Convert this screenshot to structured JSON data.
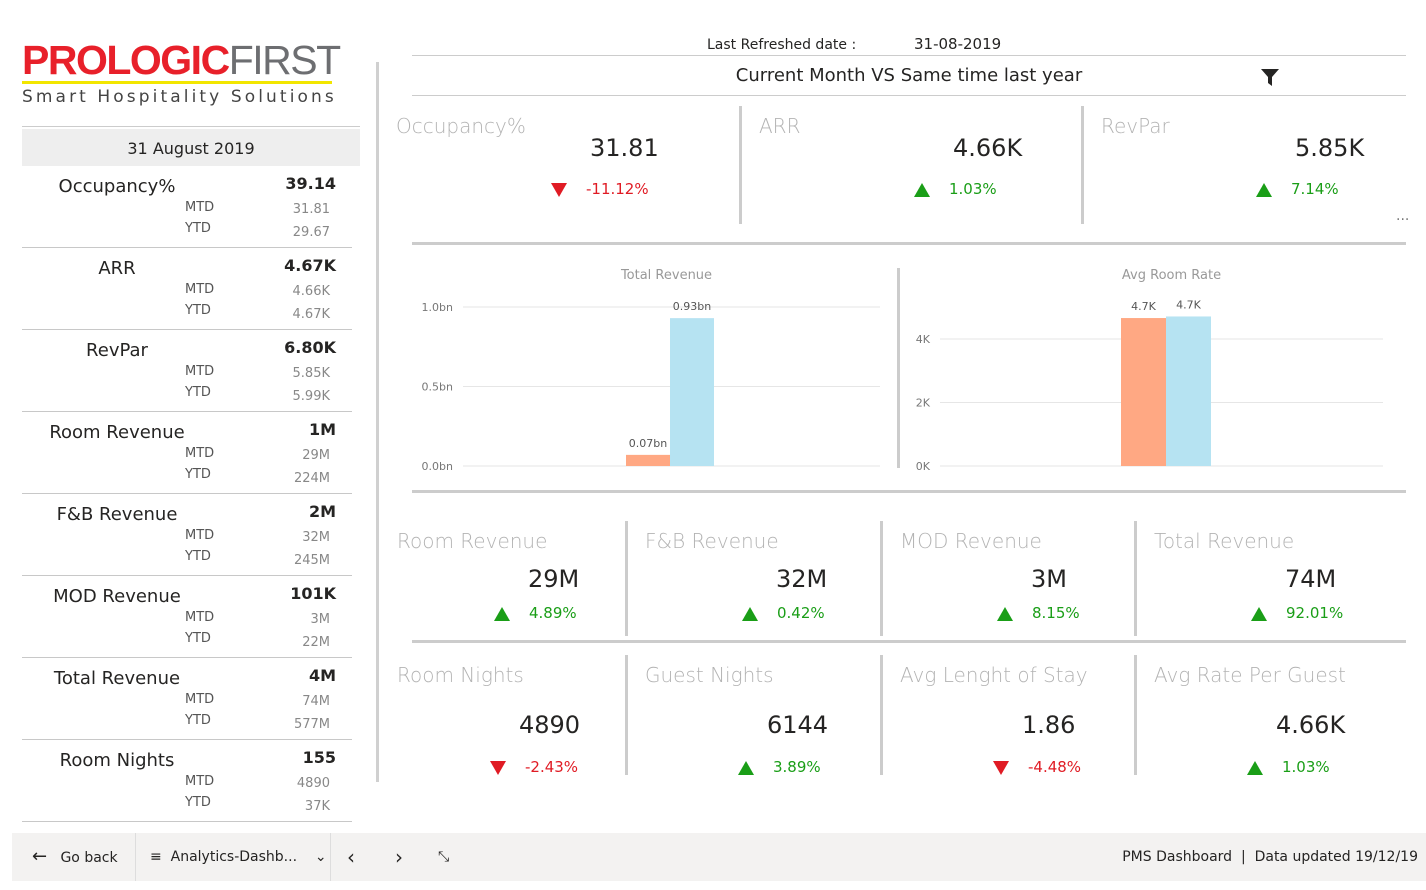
{
  "logo": {
    "brand_red": "PROLOGIC",
    "brand_grey": "FIRST",
    "tagline": "Smart Hospitality Solutions"
  },
  "header": {
    "refreshed_label": "Last Refreshed date :",
    "refreshed_value": "31-08-2019",
    "subtitle": "Current Month VS Same time last year",
    "filter_icon": "filter-icon",
    "more_icon": "..."
  },
  "left": {
    "date": "31 August 2019",
    "mtd_label": "MTD",
    "ytd_label": "YTD",
    "rows": [
      {
        "name": "Occupancy%",
        "value": "39.14",
        "mtd": "31.81",
        "ytd": "29.67"
      },
      {
        "name": "ARR",
        "value": "4.67K",
        "mtd": "4.66K",
        "ytd": "4.67K"
      },
      {
        "name": "RevPar",
        "value": "6.80K",
        "mtd": "5.85K",
        "ytd": "5.99K"
      },
      {
        "name": "Room Revenue",
        "value": "1M",
        "mtd": "29M",
        "ytd": "224M"
      },
      {
        "name": "F&B Revenue",
        "value": "2M",
        "mtd": "32M",
        "ytd": "245M"
      },
      {
        "name": "MOD Revenue",
        "value": "101K",
        "mtd": "3M",
        "ytd": "22M"
      },
      {
        "name": "Total Revenue",
        "value": "4M",
        "mtd": "74M",
        "ytd": "577M"
      },
      {
        "name": "Room Nights",
        "value": "155",
        "mtd": "4890",
        "ytd": "37K"
      }
    ]
  },
  "kpi_top": [
    {
      "title": "Occupancy%",
      "value": "31.81",
      "delta": "-11.12%",
      "dir": "down"
    },
    {
      "title": "ARR",
      "value": "4.66K",
      "delta": "1.03%",
      "dir": "up"
    },
    {
      "title": "RevPar",
      "value": "5.85K",
      "delta": "7.14%",
      "dir": "up"
    }
  ],
  "kpi_rev": [
    {
      "title": "Room Revenue",
      "value": "29M",
      "delta": "4.89%",
      "dir": "up"
    },
    {
      "title": "F&B Revenue",
      "value": "32M",
      "delta": "0.42%",
      "dir": "up"
    },
    {
      "title": "MOD Revenue",
      "value": "3M",
      "delta": "8.15%",
      "dir": "up"
    },
    {
      "title": "Total Revenue",
      "value": "74M",
      "delta": "92.01%",
      "dir": "up"
    }
  ],
  "kpi_nights": [
    {
      "title": "Room Nights",
      "value": "4890",
      "delta": "-2.43%",
      "dir": "down"
    },
    {
      "title": "Guest Nights",
      "value": "6144",
      "delta": "3.89%",
      "dir": "up"
    },
    {
      "title": "Avg Lenght of Stay",
      "value": "1.86",
      "delta": "-4.48%",
      "dir": "down"
    },
    {
      "title": "Avg Rate Per Guest",
      "value": "4.66K",
      "delta": "1.03%",
      "dir": "up"
    }
  ],
  "chart_data": [
    {
      "type": "bar",
      "title": "Total Revenue",
      "yticks": [
        "0.0bn",
        "0.5bn",
        "1.0bn"
      ],
      "ylim": [
        0,
        1.0
      ],
      "grid": true,
      "colors": [
        "#ffa883",
        "#b6e3f2"
      ],
      "values": [
        0.07,
        0.93
      ],
      "labels": [
        "0.07bn",
        "0.93bn"
      ]
    },
    {
      "type": "bar",
      "title": "Avg Room Rate",
      "yticks": [
        "0K",
        "2K",
        "4K"
      ],
      "ylim": [
        0,
        4000
      ],
      "grid": true,
      "colors": [
        "#ffa883",
        "#b6e3f2"
      ],
      "values": [
        4660,
        4710
      ],
      "labels": [
        "4.7K",
        "4.7K"
      ]
    }
  ],
  "footer": {
    "go_back": "Go back",
    "page": "Analytics-Dashb...",
    "status_left": "PMS Dashboard",
    "status_right": "Data updated 19/12/19"
  }
}
